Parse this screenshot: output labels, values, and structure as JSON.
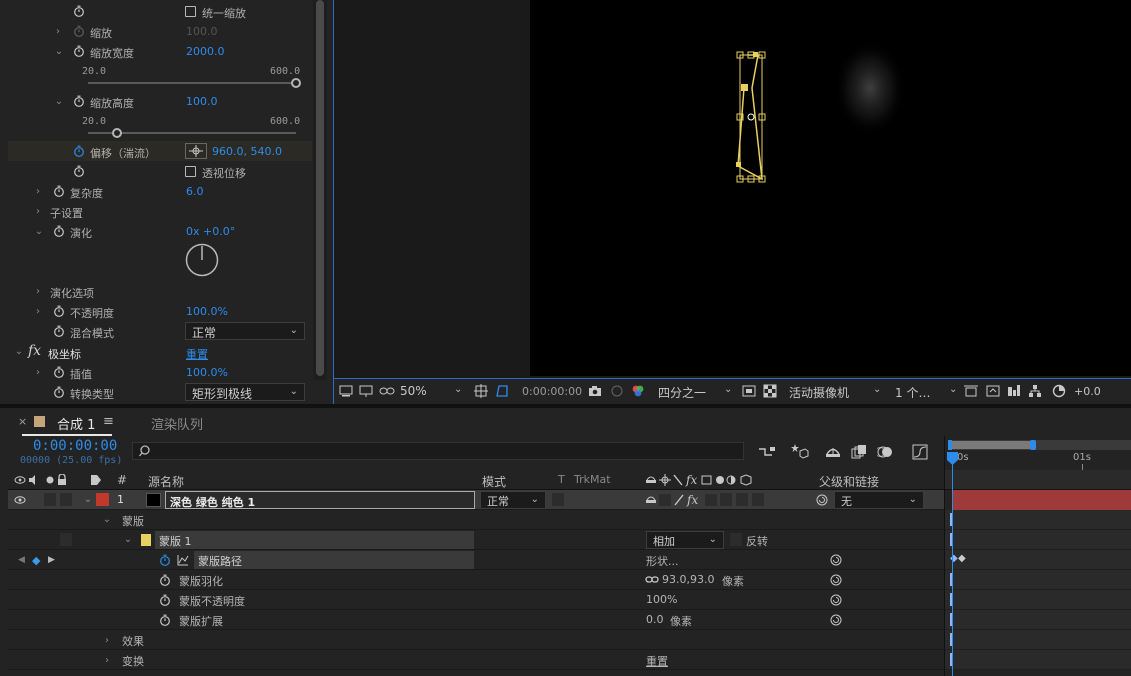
{
  "effect_controls": {
    "uniform_scale_label": "统一缩放",
    "scale_label": "缩放",
    "scale_value": "100.0",
    "scale_width_label": "缩放宽度",
    "scale_width_value": "2000.0",
    "scale_width_min": "20.0",
    "scale_width_max": "600.0",
    "scale_width_level": 1.0,
    "scale_height_label": "缩放高度",
    "scale_height_value": "100.0",
    "scale_height_min": "20.0",
    "scale_height_max": "600.0",
    "scale_height_level": 0.138,
    "offset_label": "偏移（湍流）",
    "offset_value": "960.0, 540.0",
    "perspective_offset_label": "透视位移",
    "complexity_label": "复杂度",
    "complexity_value": "6.0",
    "sub_settings_label": "子设置",
    "evolution_label": "演化",
    "evolution_value": "0x +0.0°",
    "evolution_options_label": "演化选项",
    "opacity_label": "不透明度",
    "opacity_value": "100.0%",
    "blend_mode_label": "混合模式",
    "blend_mode_value": "正常",
    "polar_fx_icon": "fx",
    "polar_label": "极坐标",
    "polar_reset": "重置",
    "interpolation_label": "插值",
    "interpolation_value": "100.0%",
    "conversion_label": "转换类型",
    "conversion_value": "矩形到极线"
  },
  "viewer_bar": {
    "zoom": "50%",
    "timecode": "0:00:00:00",
    "resolution": "四分之一",
    "camera": "活动摄像机",
    "views": "1 个…",
    "exposure": "+0.0"
  },
  "timeline": {
    "close_x": "×",
    "comp_tab": "合成 1",
    "menu_glyph": "≡",
    "render_tab": "渲染队列",
    "timecode": "0:00:00:00",
    "fps": "00000 (25.00 fps)",
    "search_placeholder": "",
    "col_hash": "#",
    "col_source": "源名称",
    "col_mode": "模式",
    "col_t": "T",
    "col_trkmat": "TrkMat",
    "col_parent": "父级和链接",
    "ruler_0": "0s",
    "ruler_1": "01s",
    "layer_num": "1",
    "layer_name": "深色 绿色 纯色 1",
    "layer_mode": "正常",
    "layer_parent": "无",
    "masks_label": "蒙版",
    "mask1_label": "蒙版 1",
    "mask_mode": "相加",
    "mask_invert": "反转",
    "mask_path_label": "蒙版路径",
    "mask_path_value": "形状...",
    "mask_feather_label": "蒙版羽化",
    "mask_feather_value": "93.0,93.0",
    "mask_feather_unit": "像素",
    "mask_opacity_label": "蒙版不透明度",
    "mask_opacity_value": "100%",
    "mask_expansion_label": "蒙版扩展",
    "mask_expansion_value": "0.0",
    "mask_expansion_unit": "像素",
    "effects_label": "效果",
    "transform_label": "变换",
    "transform_reset": "重置"
  },
  "colors": {
    "accent_blue": "#2d8ceb",
    "layer_red": "#c0392b",
    "mask_yellow": "#e8d060",
    "layer_bar": "#9e3a3a"
  }
}
